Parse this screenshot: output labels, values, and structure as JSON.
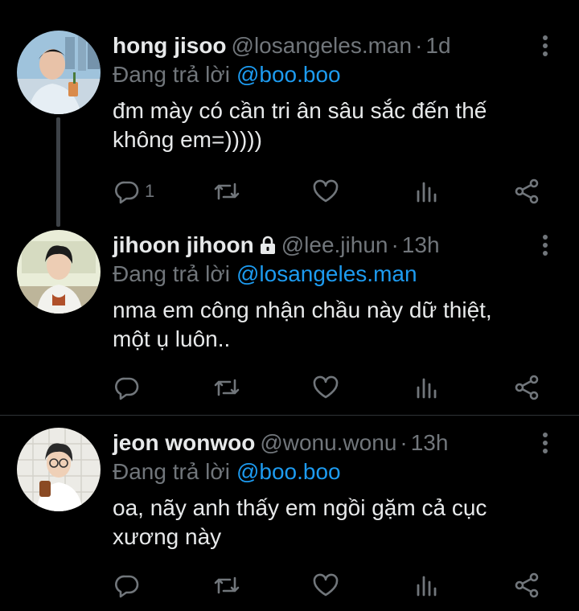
{
  "tweets": [
    {
      "name": "hong jisoo",
      "handle": "@losangeles.man",
      "time": "1d",
      "reply_prefix": "Đang trả lời",
      "reply_to": "@boo.boo",
      "text_lines": [
        "đm mày có cần tri ân sâu sắc đến thế",
        "không em=)))))"
      ],
      "reply_count": "1",
      "locked": false
    },
    {
      "name": "jihoon jihoon",
      "handle": "@lee.jihun",
      "time": "13h",
      "reply_prefix": "Đang trả lời",
      "reply_to": "@losangeles.man",
      "text_lines": [
        "nma em công nhận chầu này dữ thiệt,",
        "một ụ luôn.."
      ],
      "reply_count": "",
      "locked": true
    },
    {
      "name": "jeon wonwoo",
      "handle": "@wonu.wonu",
      "time": "13h",
      "reply_prefix": "Đang trả lời",
      "reply_to": "@boo.boo",
      "text_lines": [
        "oa, nãy anh thấy em ngồi gặm cả cục",
        "xương này"
      ],
      "reply_count": "",
      "locked": false
    }
  ],
  "separator": "·",
  "icons": {
    "reply": "reply-icon",
    "retweet": "retweet-icon",
    "like": "heart-icon",
    "views": "views-icon",
    "share": "share-icon",
    "more": "more-vertical-icon",
    "lock": "lock-icon"
  },
  "colors": {
    "background": "#000000",
    "text": "#e7e9ea",
    "muted": "#71767b",
    "link": "#1d9bf0"
  }
}
